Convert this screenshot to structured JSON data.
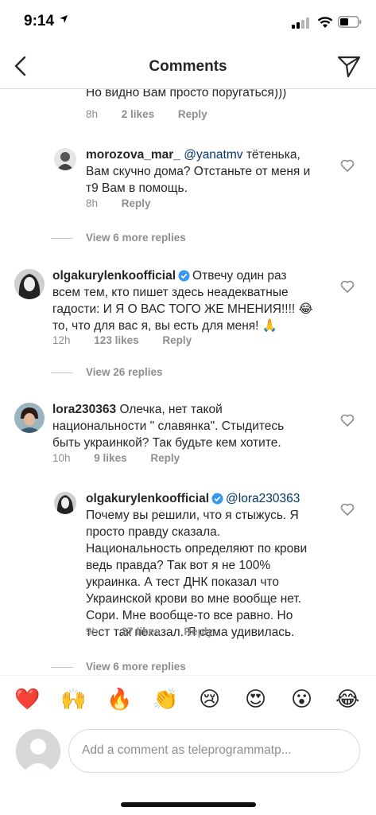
{
  "status_bar": {
    "time": "9:14"
  },
  "header": {
    "title": "Comments"
  },
  "comments": [
    {
      "text": "Но видно Вам просто поругаться)))",
      "time": "8h",
      "likes": "2 likes",
      "reply": "Reply"
    },
    {
      "username": "morozova_mar_",
      "mention": "@yanatmv",
      "text_line1": " тётенька,",
      "text_line2": "Вам скучно дома? Отстаньте от меня и",
      "text_line3": "т9 Вам в помощь.",
      "time": "8h",
      "reply": "Reply"
    },
    {
      "view_more": "View 6 more replies"
    },
    {
      "username": "olgakurylenkoofficial",
      "text_line1": "Отвечу один раз",
      "text_line2": "всем тем, кто пишет здесь неадекватные",
      "text_line3": "гадости: И Я О ВАС ТОГО ЖЕ МНЕНИЯ!!!! 😂",
      "text_line4": "то, что для вас я, вы есть для меня! 🙏",
      "time": "12h",
      "likes": "123 likes",
      "reply": "Reply"
    },
    {
      "view_more": "View 26 replies"
    },
    {
      "username": "lora230363",
      "text_line1": "Олечка, нет такой",
      "text_line2": "национальности \" славянка\". Стыдитесь",
      "text_line3": "быть украинкой?  Так будьте кем хотите.",
      "time": "10h",
      "likes": "9 likes",
      "reply": "Reply"
    },
    {
      "username": "olgakurylenkoofficial",
      "mention": "@lora230363",
      "text_line1": "Почему вы решили, что я стыжусь. Я",
      "text_line2": "просто правду сказала.",
      "text_line3": "Национальность определяют по крови",
      "text_line4": "ведь правда? Так вот я не 100%",
      "text_line5": "украинка. А тест ДНК показал что",
      "text_line6": "Украинской крови во мне вообще нет.",
      "text_line7": "Сори. Мне вообще-то все равно. Но",
      "text_line8": "тест так показал. Я сама удивилась.",
      "time": "9h",
      "likes": "27 likes",
      "reply": "Reply"
    },
    {
      "view_more": "View 6 more replies"
    }
  ],
  "reactions": [
    "❤️",
    "🙌",
    "🔥",
    "👏",
    "😢",
    "😍",
    "😮",
    "😂"
  ],
  "composer": {
    "placeholder": "Add a comment as teleprogrammatp..."
  },
  "colors": {
    "text": "#262626",
    "secondary": "#8e8e8e",
    "mention": "#00376b",
    "verified": "#3897f0"
  }
}
